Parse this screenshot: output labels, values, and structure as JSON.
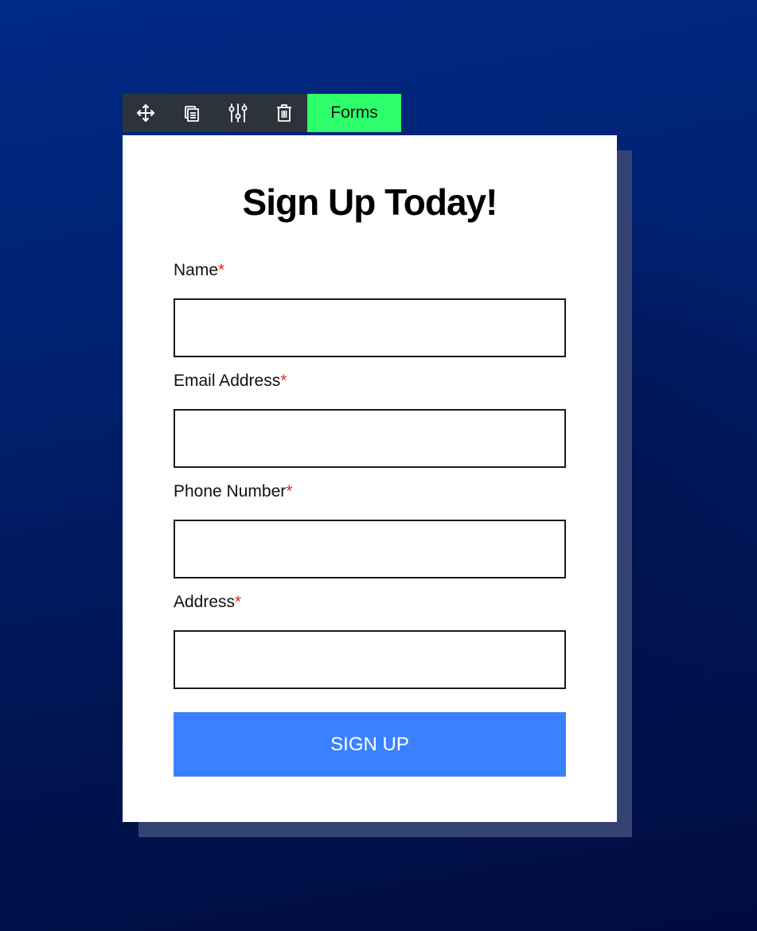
{
  "toolbar": {
    "icons": [
      "move-icon",
      "duplicate-icon",
      "settings-sliders-icon",
      "delete-icon"
    ],
    "tab_label": "Forms",
    "tab_color": "#2dff6a",
    "bar_color": "#2d333b"
  },
  "form": {
    "title": "Sign Up Today!",
    "required_marker": "*",
    "required_color": "#e4262d",
    "fields": [
      {
        "label": "Name",
        "value": "",
        "placeholder": ""
      },
      {
        "label": "Email Address",
        "value": "",
        "placeholder": ""
      },
      {
        "label": "Phone Number",
        "value": "",
        "placeholder": ""
      },
      {
        "label": "Address",
        "value": "",
        "placeholder": ""
      }
    ],
    "submit_label": "SIGN UP",
    "submit_color": "#3b81ff"
  }
}
